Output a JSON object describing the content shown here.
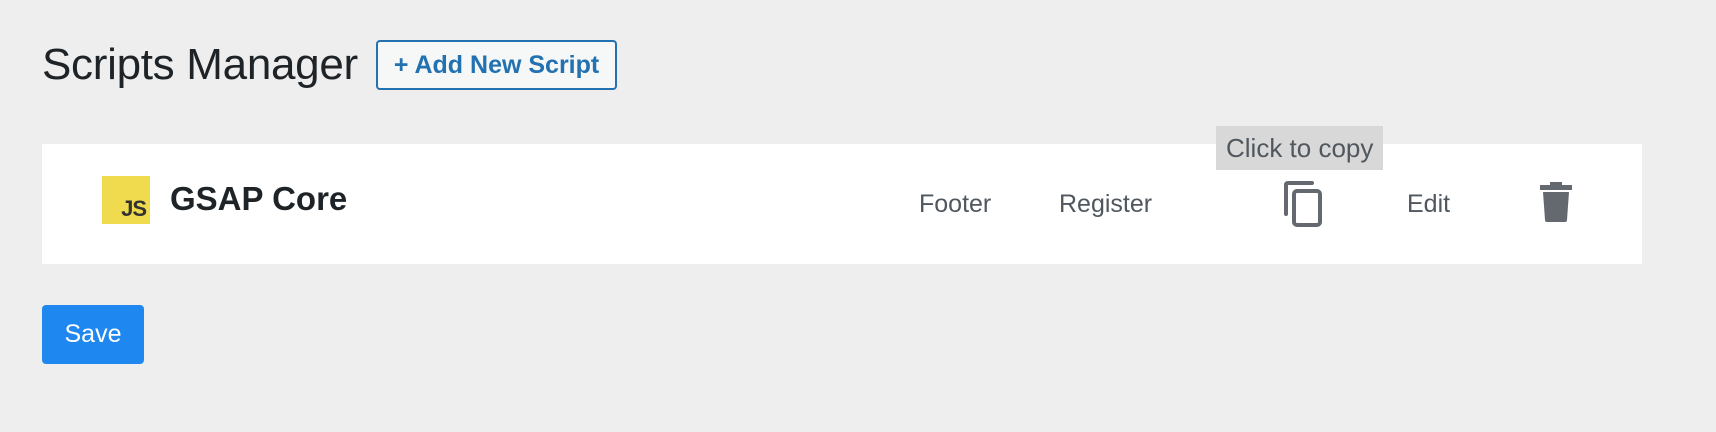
{
  "header": {
    "title": "Scripts Manager",
    "add_button_label": "+ Add New Script"
  },
  "scripts": [
    {
      "icon": "js-icon",
      "icon_text": "JS",
      "icon_color": "#f0db4f",
      "name": "GSAP Core",
      "location": "Footer",
      "mode": "Register",
      "copy_icon": "copy-icon",
      "edit_label": "Edit",
      "delete_icon": "trash-icon"
    }
  ],
  "tooltip": {
    "text": "Click to copy"
  },
  "footer": {
    "save_label": "Save"
  },
  "colors": {
    "background": "#eeeeee",
    "accent": "#2271b1",
    "save_button": "#1e87f0",
    "tooltip_bg": "#d8d8d8"
  }
}
